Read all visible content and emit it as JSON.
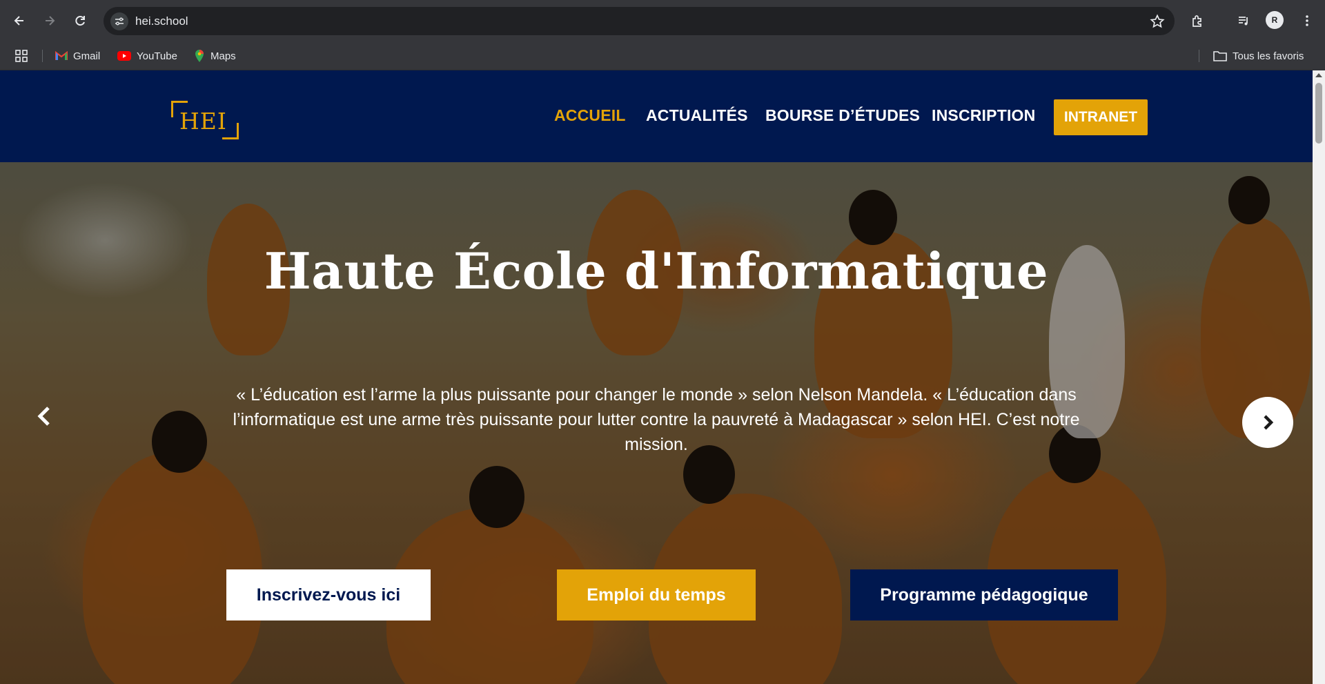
{
  "browser": {
    "url": "hei.school",
    "profile_initial": "R",
    "bookmarks": [
      {
        "label": "Gmail",
        "icon": "gmail-icon"
      },
      {
        "label": "YouTube",
        "icon": "youtube-icon"
      },
      {
        "label": "Maps",
        "icon": "maps-icon"
      }
    ],
    "all_bookmarks_label": "Tous les favoris"
  },
  "header": {
    "logo_text": "HEI",
    "nav": [
      {
        "label": "ACCUEIL",
        "active": true
      },
      {
        "label": "ACTUALITÉS",
        "active": false
      },
      {
        "label": "BOURSE D’ÉTUDES",
        "active": false
      },
      {
        "label": "INSCRIPTION",
        "active": false
      }
    ],
    "intranet_label": "INTRANET"
  },
  "hero": {
    "title": "Haute École d'Informatique",
    "quote": "« L’éducation est l’arme la plus puissante pour changer le monde » selon Nelson Mandela. « L’éducation dans l’informatique est une arme très puissante pour lutter contre la pauvreté à Madagascar » selon HEI. C’est notre mission.",
    "buttons": {
      "register": "Inscrivez-vous ici",
      "schedule": "Emploi du temps",
      "program": "Programme pédagogique"
    }
  },
  "colors": {
    "navy": "#00184f",
    "gold": "#e3a308"
  }
}
